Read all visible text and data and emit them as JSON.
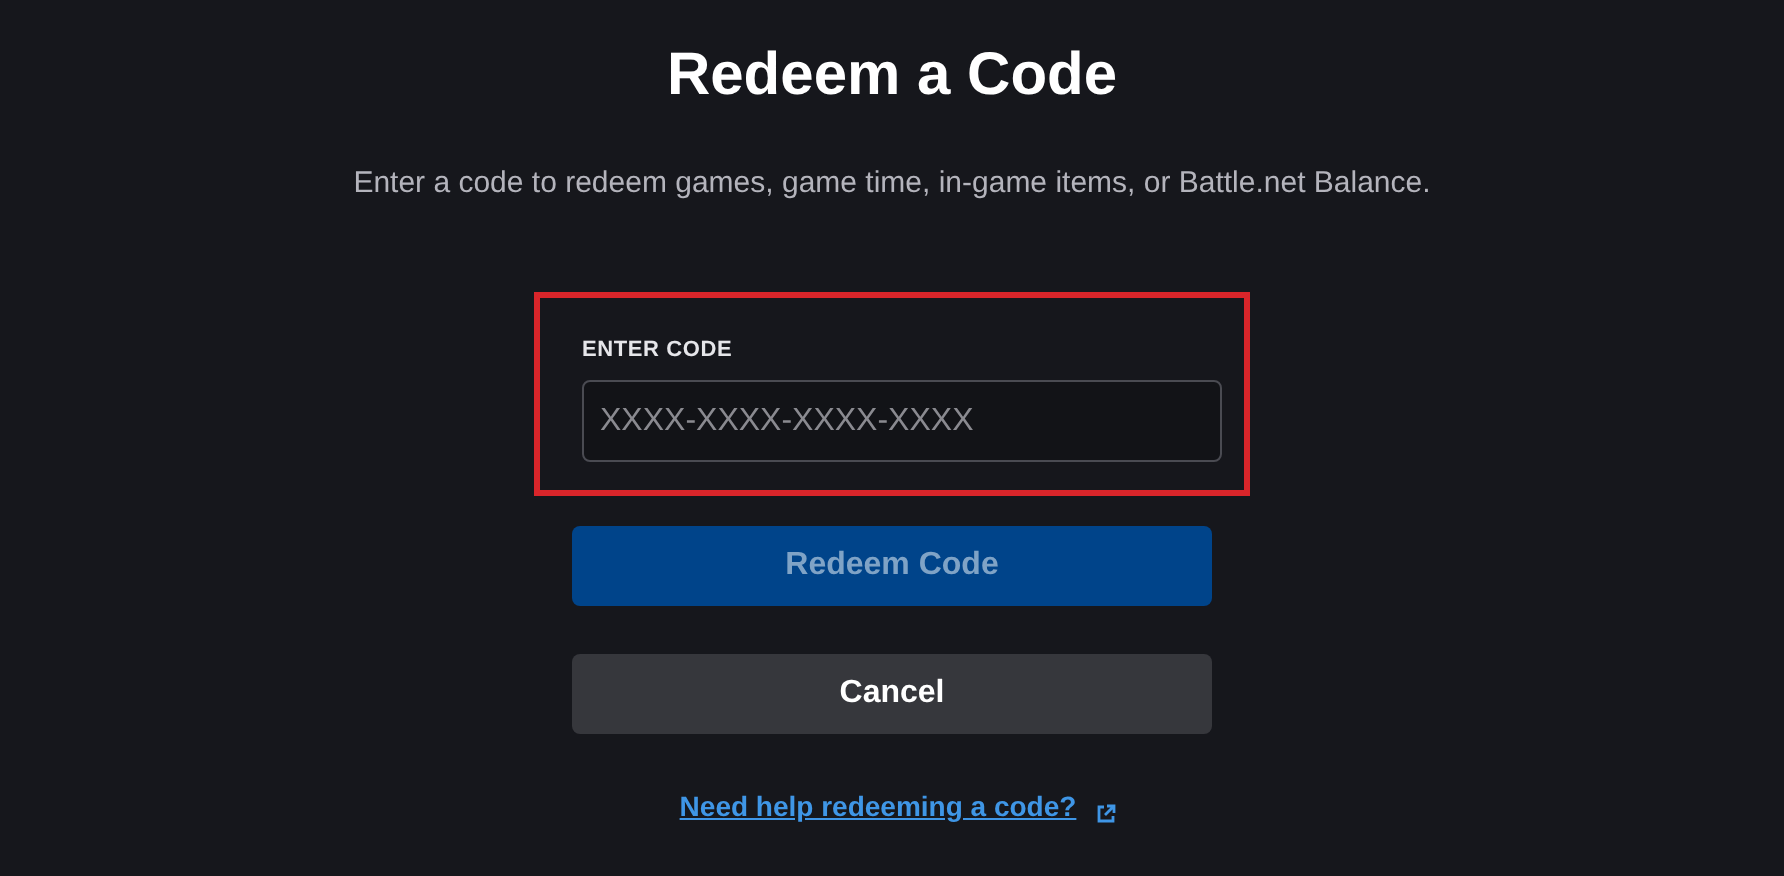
{
  "title": "Redeem a Code",
  "subtitle": "Enter a code to redeem games, game time, in-game items, or Battle.net Balance.",
  "code_field": {
    "label": "ENTER CODE",
    "placeholder": "XXXX-XXXX-XXXX-XXXX",
    "highlighted": true
  },
  "buttons": [
    {
      "label": "Redeem Code",
      "kind": "primary",
      "disabled": true
    },
    {
      "label": "Cancel",
      "kind": "secondary",
      "disabled": false
    }
  ],
  "help_link": {
    "label": "Need help redeeming a code?"
  }
}
